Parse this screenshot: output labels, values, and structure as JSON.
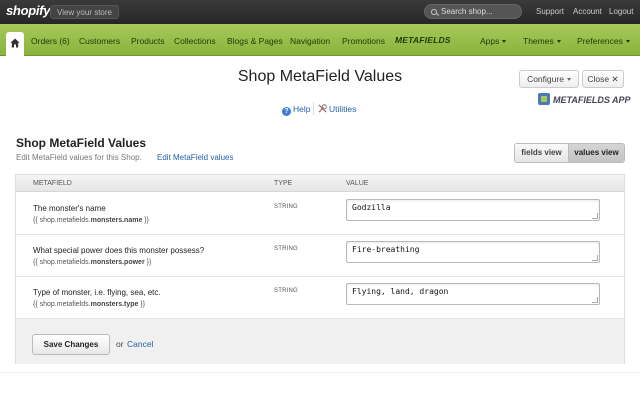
{
  "topbar": {
    "logo": "shopify",
    "view_store": "View your store",
    "search_placeholder": "Search shop...",
    "links": [
      "Support",
      "Account",
      "Logout"
    ]
  },
  "nav": {
    "items": [
      {
        "label": "Orders (6)"
      },
      {
        "label": "Customers"
      },
      {
        "label": "Products"
      },
      {
        "label": "Collections"
      },
      {
        "label": "Blogs & Pages"
      },
      {
        "label": "Navigation"
      },
      {
        "label": "Promotions"
      }
    ],
    "metafields_label": "METAFIELDS",
    "right_items": [
      {
        "label": "Apps"
      },
      {
        "label": "Themes"
      },
      {
        "label": "Preferences"
      }
    ]
  },
  "header": {
    "title": "Shop MetaField Values",
    "configure_label": "Configure",
    "close_label": "Close",
    "close_glyph": "✕",
    "app_logo_text": "METAFIELDS APP",
    "help_label": "Help",
    "utilities_label": "Utilities"
  },
  "section": {
    "title": "Shop MetaField Values",
    "subtitle": "Edit MetaField values for this Shop.",
    "edit_link": "Edit MetaField values",
    "view_fields": "fields view",
    "view_values": "values view"
  },
  "table": {
    "columns": [
      "METAFIELD",
      "TYPE",
      "VALUE"
    ],
    "rows": [
      {
        "name": "The monster's name",
        "key_prefix": "{{ shop.metafields.",
        "key_path": "monsters.name",
        "key_suffix": " }}",
        "type": "STRING",
        "value": "Godzilla"
      },
      {
        "name": "What special power does this monster possess?",
        "key_prefix": "{{ shop.metafields.",
        "key_path": "monsters.power",
        "key_suffix": " }}",
        "type": "STRING",
        "value": "Fire-breathing"
      },
      {
        "name": "Type of monster, i.e. flying, sea, etc.",
        "key_prefix": "{{ shop.metafields.",
        "key_path": "monsters.type",
        "key_suffix": " }}",
        "type": "STRING",
        "value": "Flying, land, dragon"
      }
    ],
    "save_label": "Save Changes",
    "or_text": "or",
    "cancel_label": "Cancel"
  },
  "colors": {
    "nav_green": "#89b33c",
    "link_blue": "#2563a8",
    "topbar_dark": "#262626"
  }
}
